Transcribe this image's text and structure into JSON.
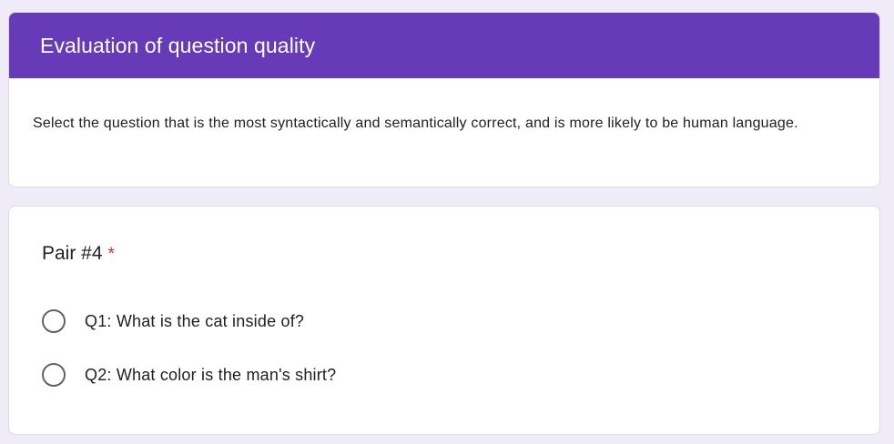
{
  "form": {
    "title": "Evaluation of question quality",
    "description": "Select the question that is the most syntactically and semantically correct, and is more likely to be human language.",
    "accent_color": "#673ab7"
  },
  "question": {
    "title": "Pair #4",
    "required_marker": "*",
    "options": [
      {
        "label": "Q1: What is the cat inside of?",
        "selected": false
      },
      {
        "label": "Q2: What color is the man's shirt?",
        "selected": false
      }
    ]
  }
}
